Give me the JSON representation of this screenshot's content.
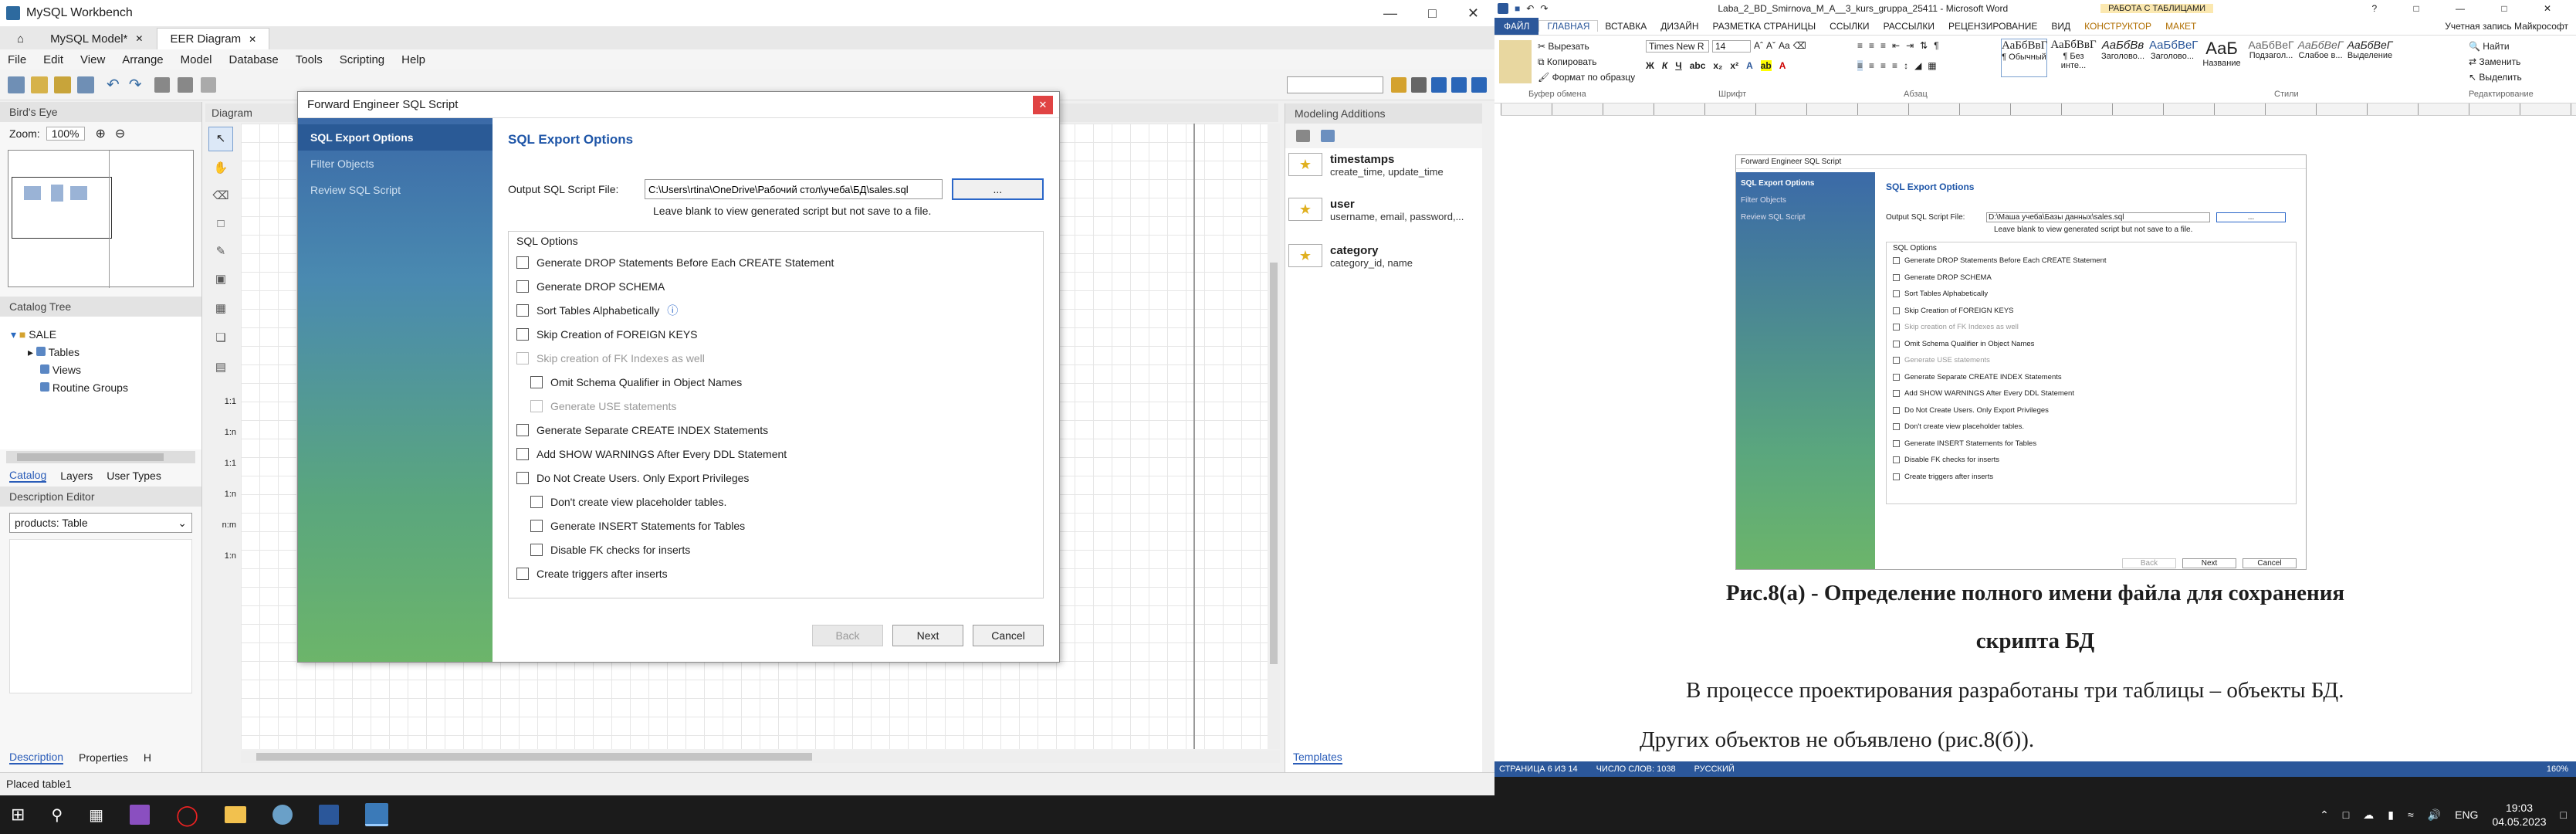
{
  "workbench": {
    "window_title": "MySQL Workbench",
    "tabs": [
      "MySQL Model*",
      "EER Diagram"
    ],
    "menu": [
      "File",
      "Edit",
      "View",
      "Arrange",
      "Model",
      "Database",
      "Tools",
      "Scripting",
      "Help"
    ],
    "birds_eye": "Bird's Eye",
    "zoom_label": "Zoom:",
    "zoom_value": "100%",
    "diagram_label": "Diagram",
    "catalog_tree": "Catalog Tree",
    "tree": {
      "schema": "SALE",
      "tables": "Tables",
      "views": "Views",
      "routines": "Routine Groups"
    },
    "left_tabs": [
      "Catalog",
      "Layers",
      "User Types"
    ],
    "description_editor": "Description Editor",
    "description_select": "products: Table",
    "bottom_tabs": [
      "Description",
      "Properties",
      "H"
    ],
    "status": "Placed table1",
    "modeling_additions": "Modeling Additions",
    "additions": [
      {
        "name": "timestamps",
        "fields": "create_time, update_time"
      },
      {
        "name": "user",
        "fields": "username, email, password,..."
      },
      {
        "name": "category",
        "fields": "category_id, name"
      }
    ],
    "templates_tab": "Templates",
    "rel_labels": [
      "1:1",
      "1:n",
      "1:1",
      "1:n",
      "n:m",
      "1:n"
    ]
  },
  "dialog": {
    "title": "Forward Engineer SQL Script",
    "steps": [
      "SQL Export Options",
      "Filter Objects",
      "Review SQL Script"
    ],
    "heading": "SQL Export Options",
    "file_label": "Output SQL Script File:",
    "file_value": "C:\\Users\\rtina\\OneDrive\\Рабочий стол\\учеба\\БД\\sales.sql",
    "browse": "...",
    "hint": "Leave blank to view generated script but not save to a file.",
    "group": "SQL Options",
    "options": [
      {
        "label": "Generate DROP Statements Before Each CREATE Statement",
        "indent": false,
        "disabled": false
      },
      {
        "label": "Generate DROP SCHEMA",
        "indent": false,
        "disabled": false
      },
      {
        "label": "Sort Tables Alphabetically",
        "indent": false,
        "disabled": false
      },
      {
        "label": "Skip Creation of FOREIGN KEYS",
        "indent": false,
        "disabled": false
      },
      {
        "label": "Skip creation of FK Indexes as well",
        "indent": false,
        "disabled": true
      },
      {
        "label": "Omit Schema Qualifier in Object Names",
        "indent": true,
        "disabled": false
      },
      {
        "label": "Generate USE statements",
        "indent": true,
        "disabled": true
      },
      {
        "label": "Generate Separate CREATE INDEX Statements",
        "indent": false,
        "disabled": false
      },
      {
        "label": "Add SHOW WARNINGS After Every DDL Statement",
        "indent": false,
        "disabled": false
      },
      {
        "label": "Do Not Create Users. Only Export Privileges",
        "indent": false,
        "disabled": false
      },
      {
        "label": "Don't create view placeholder tables.",
        "indent": true,
        "disabled": false
      },
      {
        "label": "Generate INSERT Statements for Tables",
        "indent": true,
        "disabled": false
      },
      {
        "label": "Disable FK checks for inserts",
        "indent": true,
        "disabled": false
      },
      {
        "label": "Create triggers after inserts",
        "indent": false,
        "disabled": false
      }
    ],
    "back": "Back",
    "next": "Next",
    "cancel": "Cancel"
  },
  "word": {
    "title": "Laba_2_BD_Smirnova_M_A__3_kurs_gruppa_25411 - Microsoft Word",
    "context_tab": "РАБОТА С ТАБЛИЦАМИ",
    "account": "Учетная запись Майкрософт",
    "ribbon_tabs": [
      "ФАЙЛ",
      "ГЛАВНАЯ",
      "ВСТАВКА",
      "ДИЗАЙН",
      "РАЗМЕТКА СТРАНИЦЫ",
      "ССЫЛКИ",
      "РАССЫЛКИ",
      "РЕЦЕНЗИРОВАНИЕ",
      "ВИД",
      "КОНСТРУКТОР",
      "МАКЕТ"
    ],
    "clipboard": [
      "Вырезать",
      "Копировать",
      "Формат по образцу"
    ],
    "font_name": "Times New R",
    "font_size": "14",
    "styles": [
      {
        "sample": "АаБбВвГ",
        "name": "¶ Обычный"
      },
      {
        "sample": "АаБбВвГ",
        "name": "¶ Без инте..."
      },
      {
        "sample": "АаБбВв",
        "name": "Заголово..."
      },
      {
        "sample": "АаБбВеГ",
        "name": "Заголово..."
      },
      {
        "sample": "АаБ",
        "name": "Название"
      },
      {
        "sample": "АаБбВеГ",
        "name": "Подзагол..."
      },
      {
        "sample": "АаБбВеГ",
        "name": "Слабое в..."
      },
      {
        "sample": "АаБбВеГ",
        "name": "Выделение"
      }
    ],
    "editing": [
      "Найти",
      "Заменить",
      "Выделить"
    ],
    "groups": [
      "Буфер обмена",
      "Шрифт",
      "Абзац",
      "Стили",
      "Редактирование"
    ],
    "caption_line1": "Рис.8(а) - Определение полного имени файла для сохранения",
    "caption_line2": "скрипта БД",
    "para1": "В процессе проектирования разработаны три таблицы – объекты БД.",
    "para2": "Других объектов не объявлено (рис.8(б)).",
    "embedded_file": "D:\\Маша учеба\\Базы данных\\sales.sql",
    "status": [
      "СТРАНИЦА 6 ИЗ 14",
      "ЧИСЛО СЛОВ: 1038",
      "РУССКИЙ"
    ],
    "zoom": "160%",
    "clock_time": "19:03",
    "clock_date": "04.05.2023"
  },
  "taskbar": {
    "lang": "ENG",
    "time": "19:03",
    "date": "04.05.2023"
  }
}
